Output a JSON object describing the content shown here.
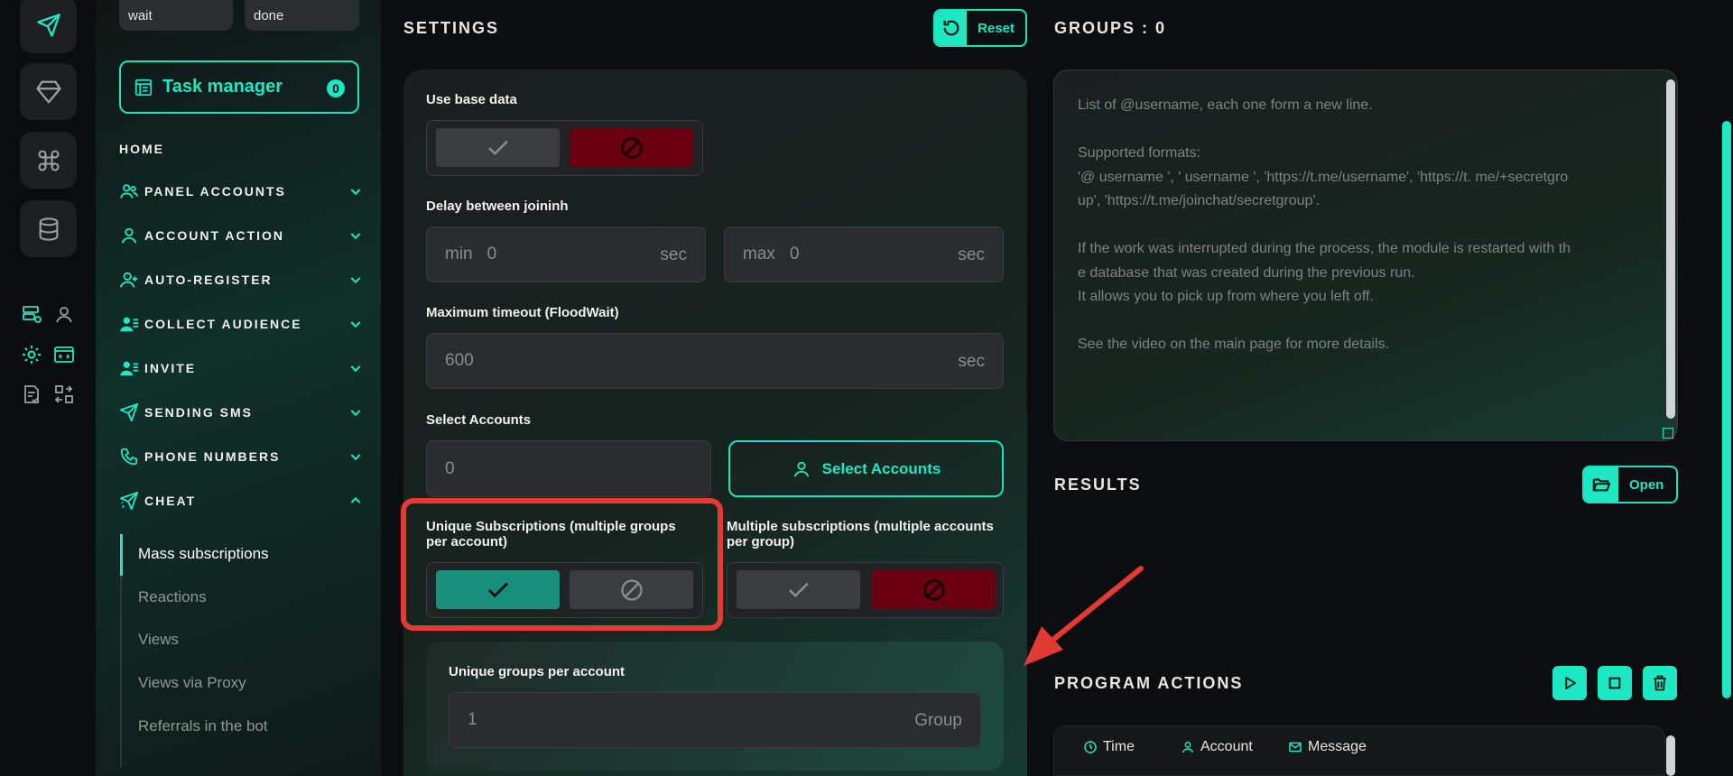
{
  "status_boxes": {
    "wait": "wait",
    "done": "done"
  },
  "task_manager": {
    "label": "Task manager",
    "count": "0"
  },
  "sidebar": {
    "home": "HOME",
    "items": [
      {
        "label": "PANEL ACCOUNTS",
        "icon": "users-icon",
        "expanded": false
      },
      {
        "label": "ACCOUNT ACTION",
        "icon": "user-icon",
        "expanded": false
      },
      {
        "label": "AUTO-REGISTER",
        "icon": "user-plus-icon",
        "expanded": false
      },
      {
        "label": "COLLECT AUDIENCE",
        "icon": "user-list-icon",
        "expanded": false
      },
      {
        "label": "INVITE",
        "icon": "user-list-icon",
        "expanded": false
      },
      {
        "label": "SENDING SMS",
        "icon": "paper-plane-icon",
        "expanded": false
      },
      {
        "label": "PHONE NUMBERS",
        "icon": "phone-icon",
        "expanded": false
      },
      {
        "label": "CHEAT",
        "icon": "paper-plane-sparkle-icon",
        "expanded": true
      }
    ],
    "sub_items": [
      {
        "label": "Mass subscriptions",
        "active": true
      },
      {
        "label": "Reactions",
        "active": false
      },
      {
        "label": "Views",
        "active": false
      },
      {
        "label": "Views via Proxy",
        "active": false
      },
      {
        "label": "Referrals in the bot",
        "active": false
      }
    ]
  },
  "settings": {
    "title": "SETTINGS",
    "reset_label": "Reset",
    "use_base_data": "Use base data",
    "delay_label": "Delay between joininh",
    "min_prefix": "min",
    "min_value": "0",
    "max_prefix": "max",
    "max_value": "0",
    "sec": "sec",
    "timeout_label": "Maximum timeout (FloodWait)",
    "timeout_value": "600",
    "select_accounts_label": "Select Accounts",
    "accounts_value": "0",
    "select_accounts_button": "Select Accounts",
    "unique_label_1": "Unique Subscriptions (multiple groups",
    "unique_label_2": "per account)",
    "multiple_label_1": "Multiple subscriptions (multiple accounts",
    "multiple_label_2": "per group)",
    "unique_groups_label": "Unique groups per account",
    "unique_groups_value": "1",
    "unique_groups_suffix": "Group"
  },
  "groups": {
    "title": "GROUPS : 0",
    "placeholder_lines": [
      "List of @username, each one form a new line.",
      "",
      "Supported formats:",
      "'@ username ', ' username ', 'https://t.me/username', 'https://t. me/+secretgro",
      "up', 'https://t.me/joinchat/secretgroup'.",
      "",
      "If the work was interrupted during the process, the module is restarted with th",
      "e database that was created during the previous run.",
      "It allows you to pick up from where you left off.",
      "",
      "See the video on the main page for more details."
    ]
  },
  "results": {
    "title": "RESULTS",
    "open_label": "Open"
  },
  "program_actions": {
    "title": "PROGRAM ACTIONS",
    "columns": [
      "Time",
      "Account",
      "Message"
    ]
  },
  "colors": {
    "accent": "#1ee8c4",
    "danger": "#6b0012",
    "highlight": "#e23a35"
  }
}
